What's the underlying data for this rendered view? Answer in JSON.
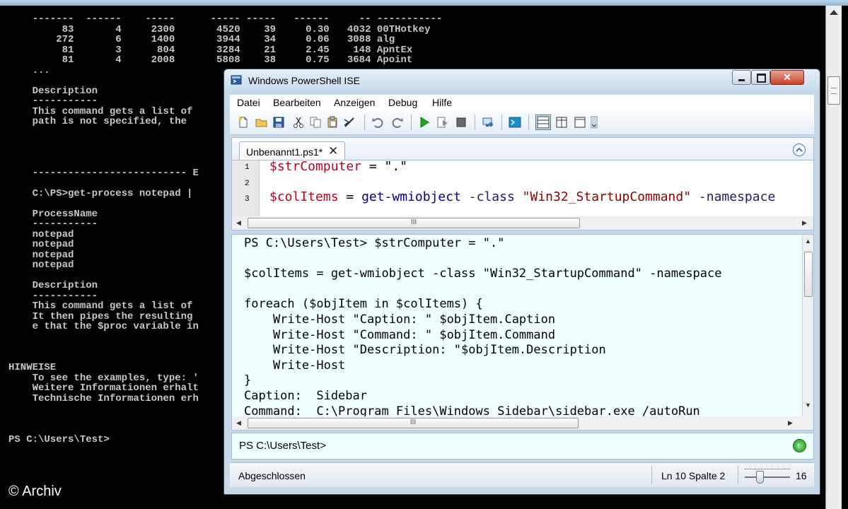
{
  "console": {
    "lines": [
      "    -------  ------    -----      ----- -----   ------     -- -----------",
      "         83       4     2300       4520    39     0.30   4032 00THotkey",
      "        272       6     1400       3944    34     0.06   3088 alg",
      "         81       3      804       3284    21     2.45    148 ApntEx",
      "         81       4     2008       5808    38     0.75   3684 Apoint",
      "    ...",
      "",
      "    Description",
      "    -----------",
      "    This command gets a list of",
      "    path is not specified, the",
      "",
      "",
      "",
      "",
      "    -------------------------- E",
      "",
      "    C:\\PS>get-process notepad |",
      "",
      "    ProcessName",
      "    -----------",
      "    notepad",
      "    notepad",
      "    notepad",
      "    notepad",
      "",
      "    Description",
      "    -----------",
      "    This command gets a list of",
      "    It then pipes the resulting",
      "    e that the $proc variable in",
      "",
      "",
      "",
      "HINWEISE",
      "    To see the examples, type: '",
      "    Weitere Informationen erhalt",
      "    Technische Informationen erh",
      "",
      "",
      "",
      "PS C:\\Users\\Test>"
    ],
    "watermark": "© Archiv"
  },
  "window": {
    "title": "Windows PowerShell ISE",
    "close_label": "✕"
  },
  "menu": [
    "Datei",
    "Bearbeiten",
    "Anzeigen",
    "Debug",
    "Hilfe"
  ],
  "editor": {
    "tab_label": "Unbenannt1.ps1*",
    "tab_close": "✕",
    "lines": [
      {
        "num": "1",
        "var": "$strComputer",
        "rest": " = \".\""
      },
      {
        "num": "2"
      },
      {
        "num": "3",
        "var": "$colItems",
        "eq": " = ",
        "cmd": "get-wmiobject",
        "param": " -class ",
        "str": "\"Win32_StartupCommand\"",
        "tail": " -namespace"
      }
    ],
    "hscroll_grip": "III"
  },
  "output": {
    "text": "PS C:\\Users\\Test> $strComputer = \".\"\n\n$colItems = get-wmiobject -class \"Win32_StartupCommand\" -namespace\n\nforeach ($objItem in $colItems) {\n    Write-Host \"Caption: \" $objItem.Caption\n    Write-Host \"Command: \" $objItem.Command\n    Write-Host \"Description: \"$objItem.Description\n    Write-Host\n}\nCaption:  Sidebar\nCommand:  C:\\Program Files\\Windows Sidebar\\sidebar.exe /autoRun",
    "hscroll_grip": "III"
  },
  "command_pane": {
    "prompt": "PS C:\\Users\\Test>"
  },
  "status": {
    "text": "Abgeschlossen",
    "position": "Ln 10  Spalte 2",
    "zoom": "16",
    "zoom_level_fraction": 0.3
  }
}
